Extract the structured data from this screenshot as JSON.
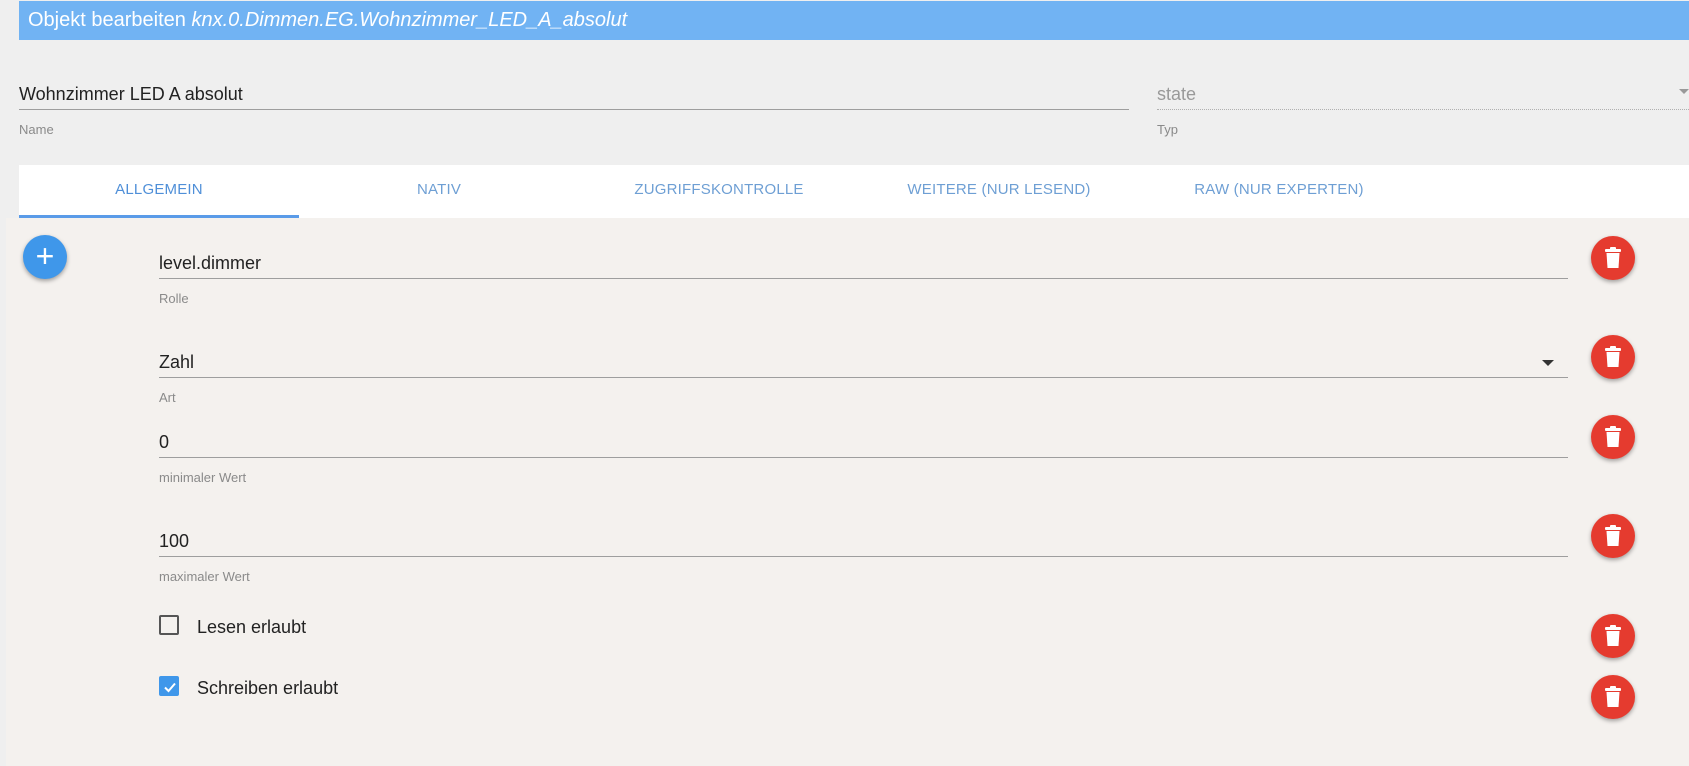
{
  "dialog": {
    "title_prefix": "Objekt bearbeiten",
    "object_id": "knx.0.Dimmen.EG.Wohnzimmer_LED_A_absolut"
  },
  "name_field": {
    "value": "Wohnzimmer LED A absolut",
    "label": "Name"
  },
  "typ_field": {
    "value": "state",
    "label": "Typ"
  },
  "tabs": [
    {
      "label": "ALLGEMEIN",
      "active": true
    },
    {
      "label": "NATIV"
    },
    {
      "label": "ZUGRIFFSKONTROLLE"
    },
    {
      "label": "WEITERE (NUR LESEND)"
    },
    {
      "label": "RAW (NUR EXPERTEN)"
    }
  ],
  "properties": {
    "role": {
      "value": "level.dimmer",
      "label": "Rolle"
    },
    "type": {
      "value": "Zahl",
      "label": "Art"
    },
    "min": {
      "value": "0",
      "label": "minimaler Wert"
    },
    "max": {
      "value": "100",
      "label": "maximaler Wert"
    },
    "read": {
      "label": "Lesen erlaubt",
      "checked": false
    },
    "write": {
      "label": "Schreiben erlaubt",
      "checked": true
    }
  },
  "icons": {
    "add": "plus-icon",
    "delete": "trash-icon",
    "check": "check-icon"
  },
  "colors": {
    "title_bar": "#71b3f3",
    "accent": "#3f97ea",
    "delete": "#e53b2f"
  }
}
